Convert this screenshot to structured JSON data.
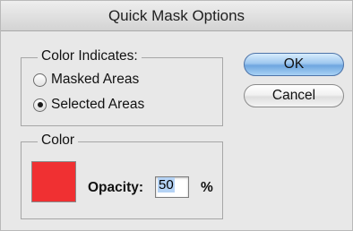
{
  "dialog": {
    "title": "Quick Mask Options"
  },
  "color_indicates": {
    "label": "Color Indicates:",
    "options": [
      {
        "label": "Masked Areas",
        "checked": false
      },
      {
        "label": "Selected Areas",
        "checked": true
      }
    ]
  },
  "color": {
    "label": "Color",
    "swatch_color": "#f03032",
    "opacity_label": "Opacity:",
    "opacity_value": "50",
    "opacity_unit": "%"
  },
  "buttons": {
    "ok_label": "OK",
    "cancel_label": "Cancel"
  }
}
